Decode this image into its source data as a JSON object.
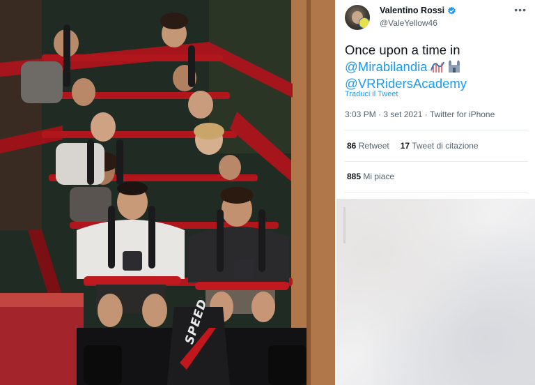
{
  "tweet": {
    "display_name": "Valentino Rossi",
    "handle": "@ValeYellow46",
    "more_label": "•••",
    "text_line1": "Once upon a time in",
    "mention1": "@Mirabilandia",
    "mention2": "@VRRidersAcademy",
    "translate_label": "Traduci il Tweet",
    "time": "3:03 PM",
    "separator": "·",
    "date": "3 set 2021",
    "source": "Twitter for iPhone",
    "retweets_count": "86",
    "retweets_label": "Retweet",
    "quotes_count": "17",
    "quotes_label": "Tweet di citazione",
    "likes_count": "885",
    "likes_label": "Mi piace"
  },
  "photo": {
    "ride_logo": "SPEED"
  },
  "icons": {
    "verified": "verified-badge-icon",
    "coaster_emoji": "roller-coaster-icon",
    "castle_emoji": "castle-icon",
    "more": "more-options-icon"
  },
  "colors": {
    "link": "#1d9bf0",
    "text": "#0f1419",
    "muted": "#536471",
    "coaster_red": "#c0161c"
  }
}
